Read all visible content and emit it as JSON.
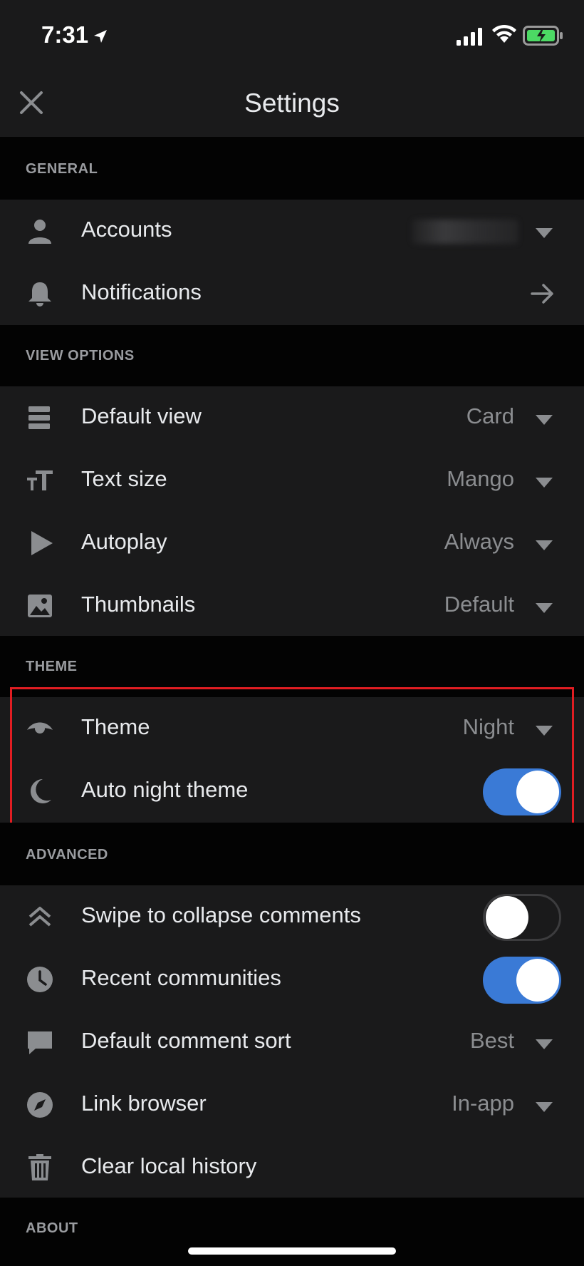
{
  "status_bar": {
    "time": "7:31"
  },
  "header": {
    "title": "Settings"
  },
  "sections": {
    "general": {
      "title": "GENERAL",
      "items": [
        {
          "label": "Accounts",
          "icon": "person-icon"
        },
        {
          "label": "Notifications",
          "icon": "bell-icon"
        }
      ]
    },
    "view_options": {
      "title": "VIEW OPTIONS",
      "items": [
        {
          "label": "Default view",
          "value": "Card",
          "icon": "list-icon"
        },
        {
          "label": "Text size",
          "value": "Mango",
          "icon": "text-size-icon"
        },
        {
          "label": "Autoplay",
          "value": "Always",
          "icon": "play-icon"
        },
        {
          "label": "Thumbnails",
          "value": "Default",
          "icon": "image-icon"
        }
      ]
    },
    "theme": {
      "title": "THEME",
      "items": [
        {
          "label": "Theme",
          "value": "Night",
          "icon": "eye-icon"
        },
        {
          "label": "Auto night theme",
          "toggle": true,
          "icon": "moon-icon"
        }
      ]
    },
    "advanced": {
      "title": "ADVANCED",
      "items": [
        {
          "label": "Swipe to collapse comments",
          "toggle": false,
          "icon": "double-chevron-up-icon"
        },
        {
          "label": "Recent communities",
          "toggle": true,
          "icon": "clock-icon"
        },
        {
          "label": "Default comment sort",
          "value": "Best",
          "icon": "comment-icon"
        },
        {
          "label": "Link browser",
          "value": "In-app",
          "icon": "compass-icon"
        },
        {
          "label": "Clear local history",
          "icon": "trash-icon"
        }
      ]
    },
    "about": {
      "title": "ABOUT"
    }
  },
  "colors": {
    "background": "#030303",
    "surface": "#1a1a1b",
    "toggle_on": "#3a7ad6",
    "highlight": "#e11d22"
  }
}
